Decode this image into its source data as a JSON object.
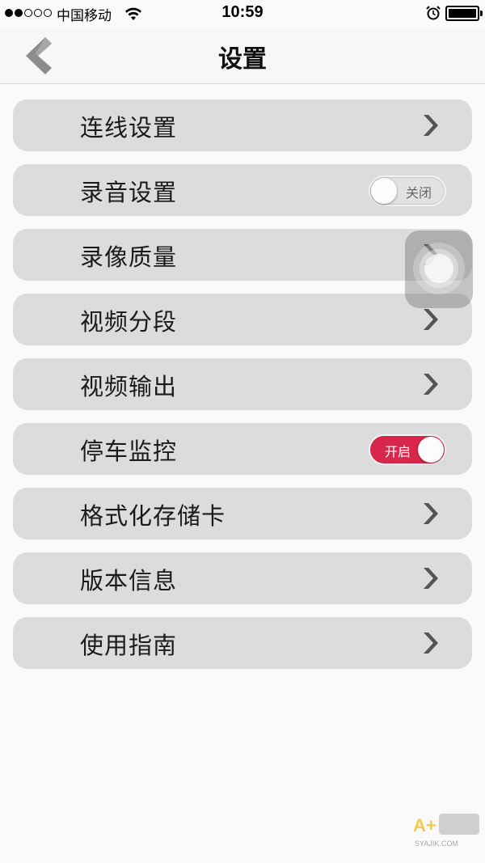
{
  "status_bar": {
    "carrier": "中国移动",
    "time": "10:59",
    "signal_dots": [
      true,
      true,
      false,
      false,
      false
    ]
  },
  "nav": {
    "title": "设置",
    "back_icon": "chevron-left-icon"
  },
  "settings": {
    "items": [
      {
        "label": "连线设置",
        "control": "chevron"
      },
      {
        "label": "录音设置",
        "control": "toggle",
        "toggle_text": "关闭",
        "toggle_on": false
      },
      {
        "label": "录像质量",
        "control": "chevron"
      },
      {
        "label": "视频分段",
        "control": "chevron"
      },
      {
        "label": "视频输出",
        "control": "chevron"
      },
      {
        "label": "停车监控",
        "control": "toggle",
        "toggle_text": "开启",
        "toggle_on": true
      },
      {
        "label": "格式化存储卡",
        "control": "chevron"
      },
      {
        "label": "版本信息",
        "control": "chevron"
      },
      {
        "label": "使用指南",
        "control": "chevron"
      }
    ]
  },
  "watermark": {
    "text": "A+ SYAJIK.COM"
  },
  "colors": {
    "row_background": "#dcdcde",
    "toggle_on": "#d9264b",
    "chevron": "#555555",
    "back_chevron": "#8a8a8a"
  }
}
